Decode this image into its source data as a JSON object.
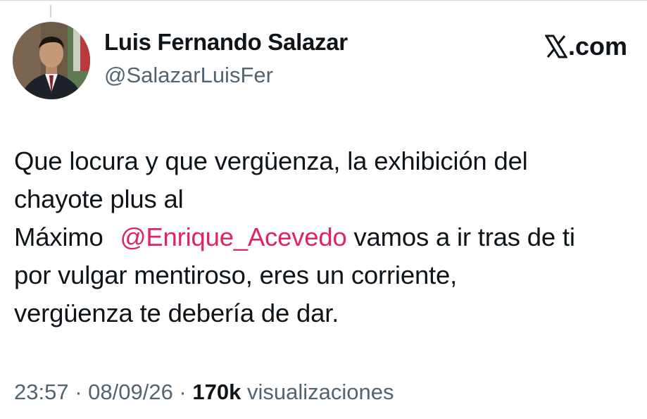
{
  "author": {
    "name": "Luis Fernando Salazar",
    "handle": "@SalazarLuisFer"
  },
  "brand": {
    "label": ".com",
    "icon": "x-logo-icon"
  },
  "tweet": {
    "line1": "Que locura y que vergüenza, la exhibición del",
    "line2": "chayote plus al",
    "line3_before": "Máximo",
    "mention": "@Enrique_Acevedo",
    "line3_after": "vamos a ir tras de ti",
    "line4": "por vulgar mentiroso, eres un corriente,",
    "line5": "vergüenza te debería de dar."
  },
  "meta": {
    "time": "23:57",
    "sep1": " · ",
    "date": "08/09/26",
    "sep2": " · ",
    "views_count": "170k",
    "views_label": " visualizaciones"
  },
  "colors": {
    "text": "#0f1419",
    "secondary": "#536471",
    "mention": "#e0245e"
  }
}
